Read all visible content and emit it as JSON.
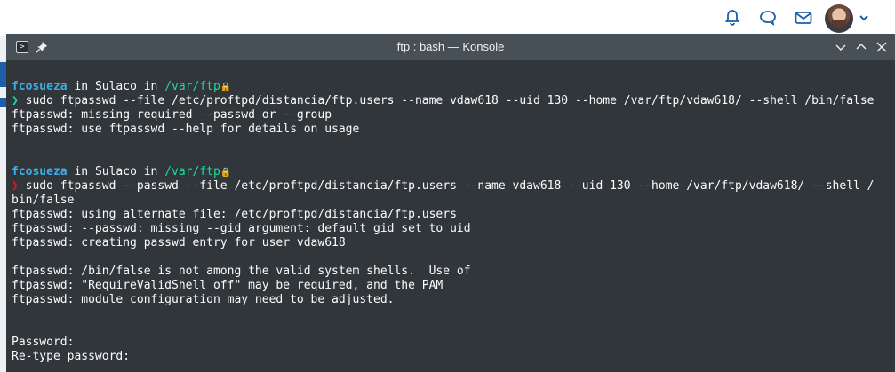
{
  "window": {
    "title": "ftp : bash — Konsole",
    "terminal_icon_glyph": ">"
  },
  "terminal": {
    "block1": {
      "prompt_user": "fcosueza",
      "prompt_in1": " in ",
      "prompt_host": "Sulaco",
      "prompt_in2": " in ",
      "prompt_path": "/var/ftp",
      "arrow": "❯",
      "command": " sudo ftpasswd --file /etc/proftpd/distancia/ftp.users --name vdaw618 --uid 130 --home /var/ftp/vdaw618/ --shell /bin/false",
      "output": [
        "ftpasswd: missing required --passwd or --group",
        "ftpasswd: use ftpasswd --help for details on usage"
      ]
    },
    "block2": {
      "prompt_user": "fcosueza",
      "prompt_in1": " in ",
      "prompt_host": "Sulaco",
      "prompt_in2": " in ",
      "prompt_path": "/var/ftp",
      "arrow": "❯",
      "command": " sudo ftpasswd --passwd --file /etc/proftpd/distancia/ftp.users --name vdaw618 --uid 130 --home /var/ftp/vdaw618/ --shell /",
      "command_wrap": "bin/false",
      "output": [
        "ftpasswd: using alternate file: /etc/proftpd/distancia/ftp.users",
        "ftpasswd: --passwd: missing --gid argument: default gid set to uid",
        "ftpasswd: creating passwd entry for user vdaw618",
        "",
        "ftpasswd: /bin/false is not among the valid system shells.  Use of",
        "ftpasswd: \"RequireValidShell off\" may be required, and the PAM",
        "ftpasswd: module configuration may need to be adjusted.",
        "",
        "",
        "Password:",
        "Re-type password:"
      ]
    }
  },
  "colors": {
    "window_bg": "#31363b",
    "titlebar_bg": "#475057",
    "user": "#3daee9",
    "path": "#1cdc9a",
    "arrow_ok": "#1cdc9a",
    "arrow_error": "#ed1515",
    "lock": "#fdbc4b"
  }
}
